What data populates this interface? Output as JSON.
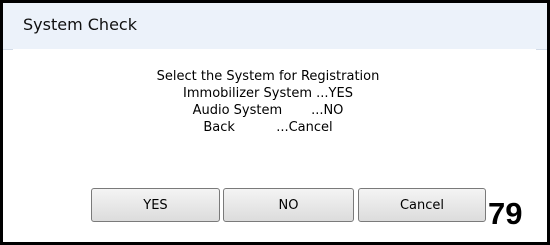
{
  "window": {
    "title": "System Check"
  },
  "message": {
    "lines": [
      "Select the System for Registration",
      "Immobilizer System ...YES",
      "Audio System       ...NO",
      "Back          ...Cancel"
    ]
  },
  "buttons": {
    "yes_label": "YES",
    "no_label": "NO",
    "cancel_label": "Cancel"
  },
  "page_number": "79"
}
